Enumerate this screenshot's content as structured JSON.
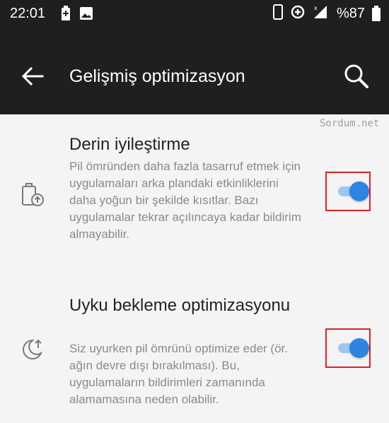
{
  "status_bar": {
    "time": "22:01",
    "battery_percent": "%87",
    "icons": [
      "battery-saver-icon",
      "image-icon",
      "phone-icon",
      "data-saver-icon",
      "signal-icon",
      "battery-icon"
    ]
  },
  "toolbar": {
    "title": "Gelişmiş optimizasyon",
    "back_icon": "arrow-left-icon",
    "search_icon": "search-icon"
  },
  "watermark": "Sordum.net",
  "settings": [
    {
      "title": "Derin iyileştirme",
      "description": "Pil ömründen daha fazla tasarruf etmek için uygulamaları arka plandaki etkinliklerini daha yoğun bir şekilde kısıtlar. Bazı uygulamalar tekrar açılıncaya kadar bildirim almayabilir.",
      "icon": "battery-optimize-icon",
      "enabled": true
    },
    {
      "title": "Uyku bekleme optimizasyonu",
      "description": "Siz uyurken pil ömrünü optimize eder (ör. ağın devre dışı bırakılması). Bu, uygulamaların bildirimleri zamanında alamamasına neden olabilir.",
      "icon": "sleep-moon-icon",
      "enabled": true
    }
  ],
  "colors": {
    "toolbar_bg": "#1f1f1f",
    "page_bg": "#f4f4f4",
    "toggle_thumb": "#2a86e0",
    "toggle_track": "#9dc7ef",
    "highlight_border": "#dd2222"
  }
}
